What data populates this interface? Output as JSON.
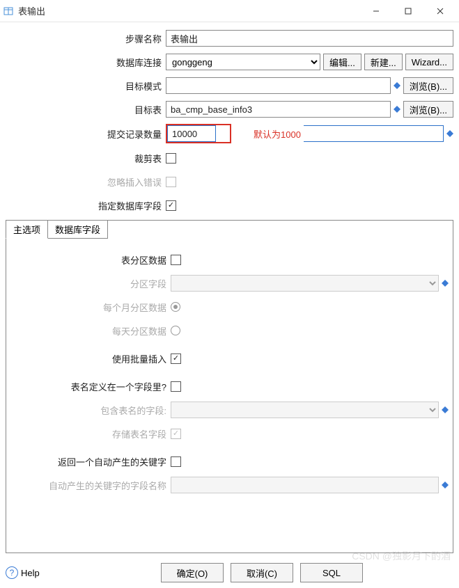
{
  "window": {
    "title": "表输出"
  },
  "labels": {
    "step_name": "步骤名称",
    "db_connection": "数据库连接",
    "target_schema": "目标模式",
    "target_table": "目标表",
    "commit_size": "提交记录数量",
    "truncate": "裁剪表",
    "ignore_errors": "忽略插入错误",
    "specify_fields": "指定数据库字段",
    "partition_data": "表分区数据",
    "partition_field": "分区字段",
    "partition_monthly": "每个月分区数据",
    "partition_daily": "每天分区数据",
    "use_batch": "使用批量插入",
    "name_in_field": "表名定义在一个字段里?",
    "field_with_name": "包含表名的字段:",
    "store_name_field": "存储表名字段",
    "return_keys": "返回一个自动产生的关键字",
    "autogen_key_field": "自动产生的关键字的字段名称"
  },
  "values": {
    "step_name": "表输出",
    "db_connection": "gonggeng",
    "target_schema": "",
    "target_table": "ba_cmp_base_info3",
    "commit_size": "10000",
    "autogen_key_field": ""
  },
  "buttons": {
    "edit": "编辑...",
    "new": "新建...",
    "wizard": "Wizard...",
    "browse": "浏览(B)...",
    "ok": "确定(O)",
    "cancel": "取消(C)",
    "sql": "SQL",
    "help": "Help"
  },
  "tabs": {
    "main": "主选项",
    "fields": "数据库字段"
  },
  "annotations": {
    "commit_default": "默认为1000"
  },
  "watermark": "CSDN @独影月下酌酒"
}
